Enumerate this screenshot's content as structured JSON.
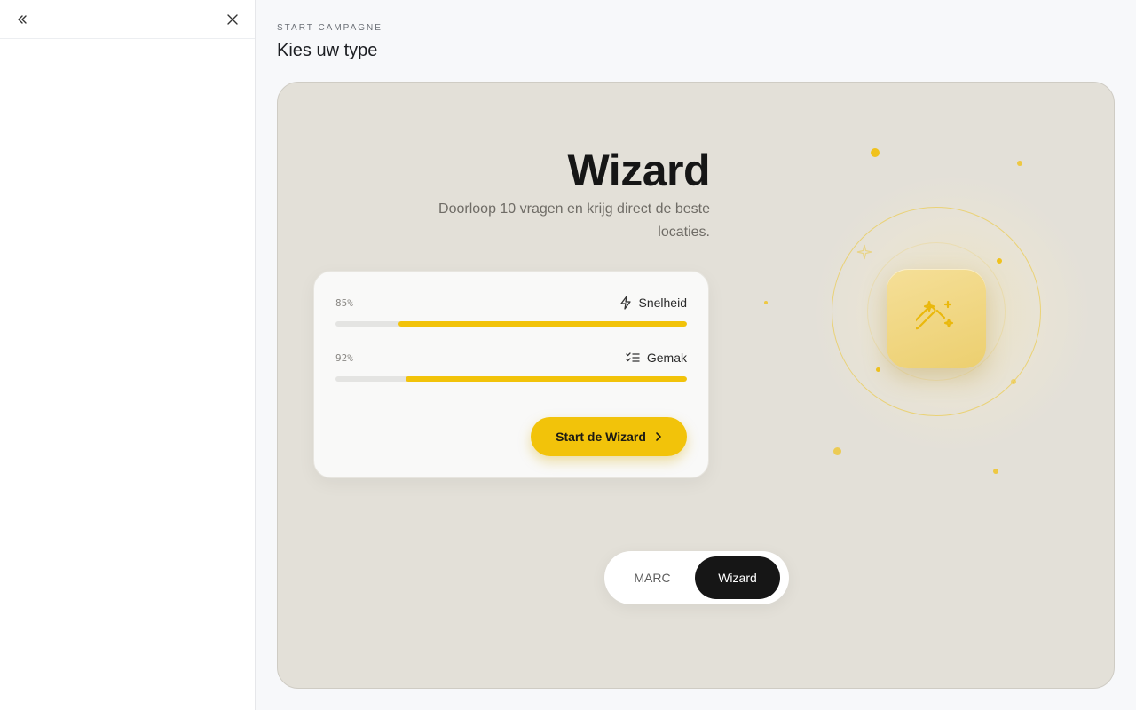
{
  "sidebar": {
    "collapse_icon": "chevrons-left-icon",
    "close_icon": "close-icon"
  },
  "header": {
    "eyebrow": "START CAMPAGNE",
    "title": "Kies uw type"
  },
  "hero": {
    "title": "Wizard",
    "description": "Doorloop 10 vragen en krijg direct de beste locaties."
  },
  "metrics": [
    {
      "percent_label": "85%",
      "label": "Snelheid",
      "icon": "zap-icon",
      "fill": 0.82
    },
    {
      "percent_label": "92%",
      "label": "Gemak",
      "icon": "list-checks-icon",
      "fill": 0.8
    }
  ],
  "cta": {
    "label": "Start de Wizard",
    "icon": "chevron-right-icon"
  },
  "illustration": {
    "icon": "magic-wand-icon",
    "accent": "#f2c30a"
  },
  "toggle": {
    "options": [
      "MARC",
      "Wizard"
    ],
    "selected": "Wizard"
  },
  "colors": {
    "accent": "#f2c30a",
    "card_bg": "#e3e0d8",
    "dark": "#161616"
  }
}
